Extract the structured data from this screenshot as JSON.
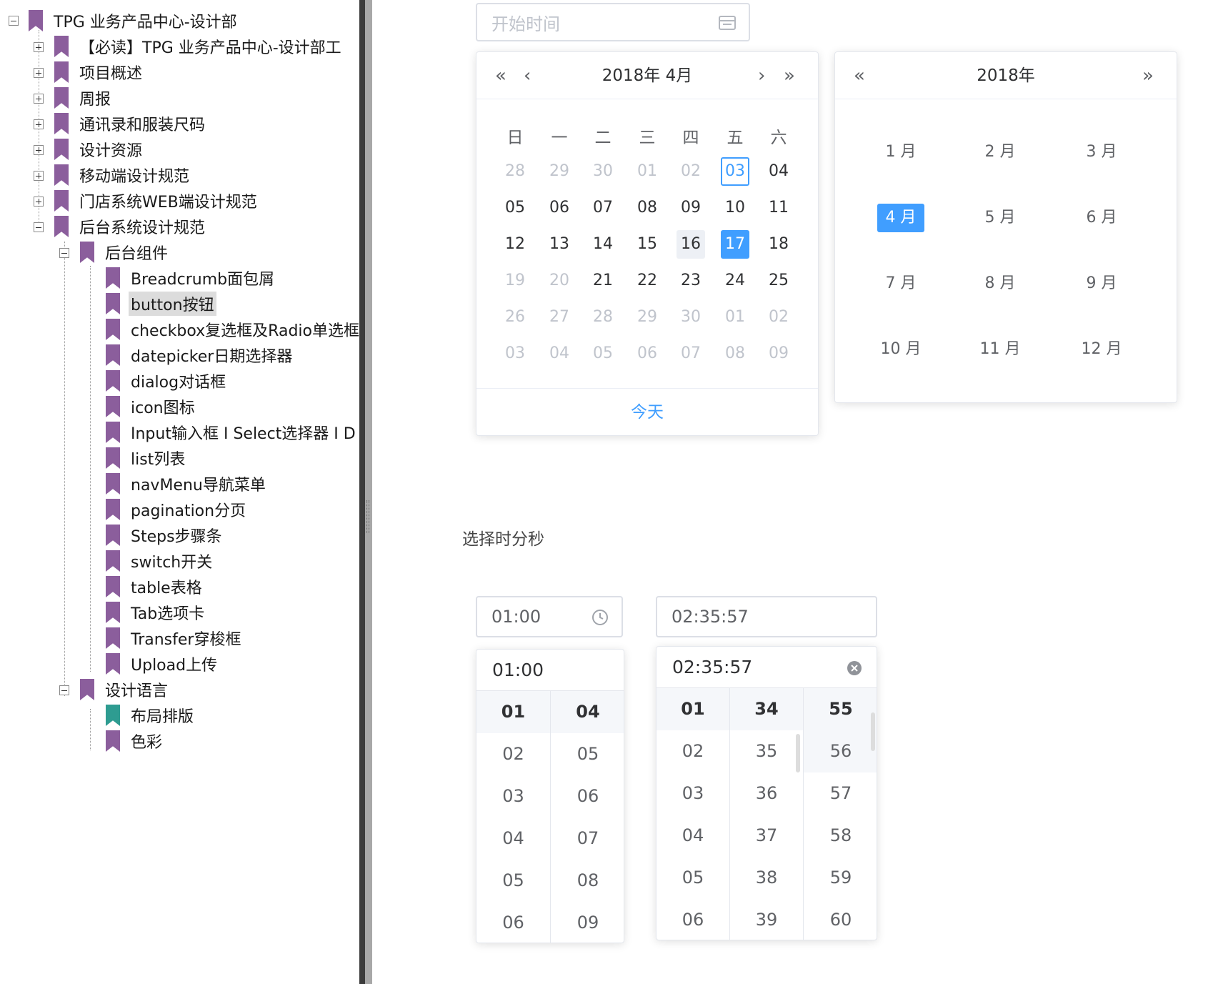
{
  "tree": {
    "root": "TPG 业务产品中心-设计部",
    "level1": [
      "【必读】TPG 业务产品中心-设计部工",
      "项目概述",
      "周报",
      "通讯录和服装尺码",
      "设计资源",
      "移动端设计规范",
      "门店系统WEB端设计规范",
      "后台系统设计规范"
    ],
    "group1": "后台组件",
    "components": [
      "Breadcrumb面包屑",
      "button按钮",
      "checkbox复选框及Radio单选框",
      "datepicker日期选择器",
      "dialog对话框",
      "icon图标",
      "Input输入框 I Select选择器 I D",
      "list列表",
      "navMenu导航菜单",
      "pagination分页",
      "Steps步骤条",
      "switch开关",
      "table表格",
      "Tab选项卡",
      "Transfer穿梭框",
      "Upload上传"
    ],
    "group2": "设计语言",
    "design": [
      "布局排版",
      "色彩"
    ]
  },
  "date_input": {
    "placeholder": "开始时间"
  },
  "calendar": {
    "title": "2018年 4月",
    "weekdays": [
      "日",
      "一",
      "二",
      "三",
      "四",
      "五",
      "六"
    ],
    "rows": [
      [
        "28",
        "29",
        "30",
        "01",
        "02",
        "03",
        "04"
      ],
      [
        "05",
        "06",
        "07",
        "08",
        "09",
        "10",
        "11"
      ],
      [
        "12",
        "13",
        "14",
        "15",
        "16",
        "17",
        "18"
      ],
      [
        "19",
        "20",
        "21",
        "22",
        "23",
        "24",
        "25"
      ],
      [
        "26",
        "27",
        "28",
        "29",
        "30",
        "01",
        "02"
      ],
      [
        "03",
        "04",
        "05",
        "06",
        "07",
        "08",
        "09"
      ]
    ],
    "today_label": "今天"
  },
  "month_panel": {
    "title": "2018年",
    "months": [
      "1 月",
      "2 月",
      "3 月",
      "4 月",
      "5 月",
      "6 月",
      "7 月",
      "8 月",
      "9 月",
      "10 月",
      "11 月",
      "12 月"
    ]
  },
  "time_section": {
    "title": "选择时分秒"
  },
  "time_a": {
    "value": "01:00",
    "header": "01:00",
    "hours": [
      "01",
      "02",
      "03",
      "04",
      "05",
      "06"
    ],
    "minutes": [
      "04",
      "05",
      "06",
      "07",
      "08",
      "09"
    ]
  },
  "time_b": {
    "value": "02:35:57",
    "header": "02:35:57",
    "hours": [
      "01",
      "02",
      "03",
      "04",
      "05",
      "06"
    ],
    "minutes": [
      "34",
      "35",
      "36",
      "37",
      "38",
      "39"
    ],
    "seconds": [
      "55",
      "56",
      "57",
      "58",
      "59",
      "60"
    ]
  }
}
